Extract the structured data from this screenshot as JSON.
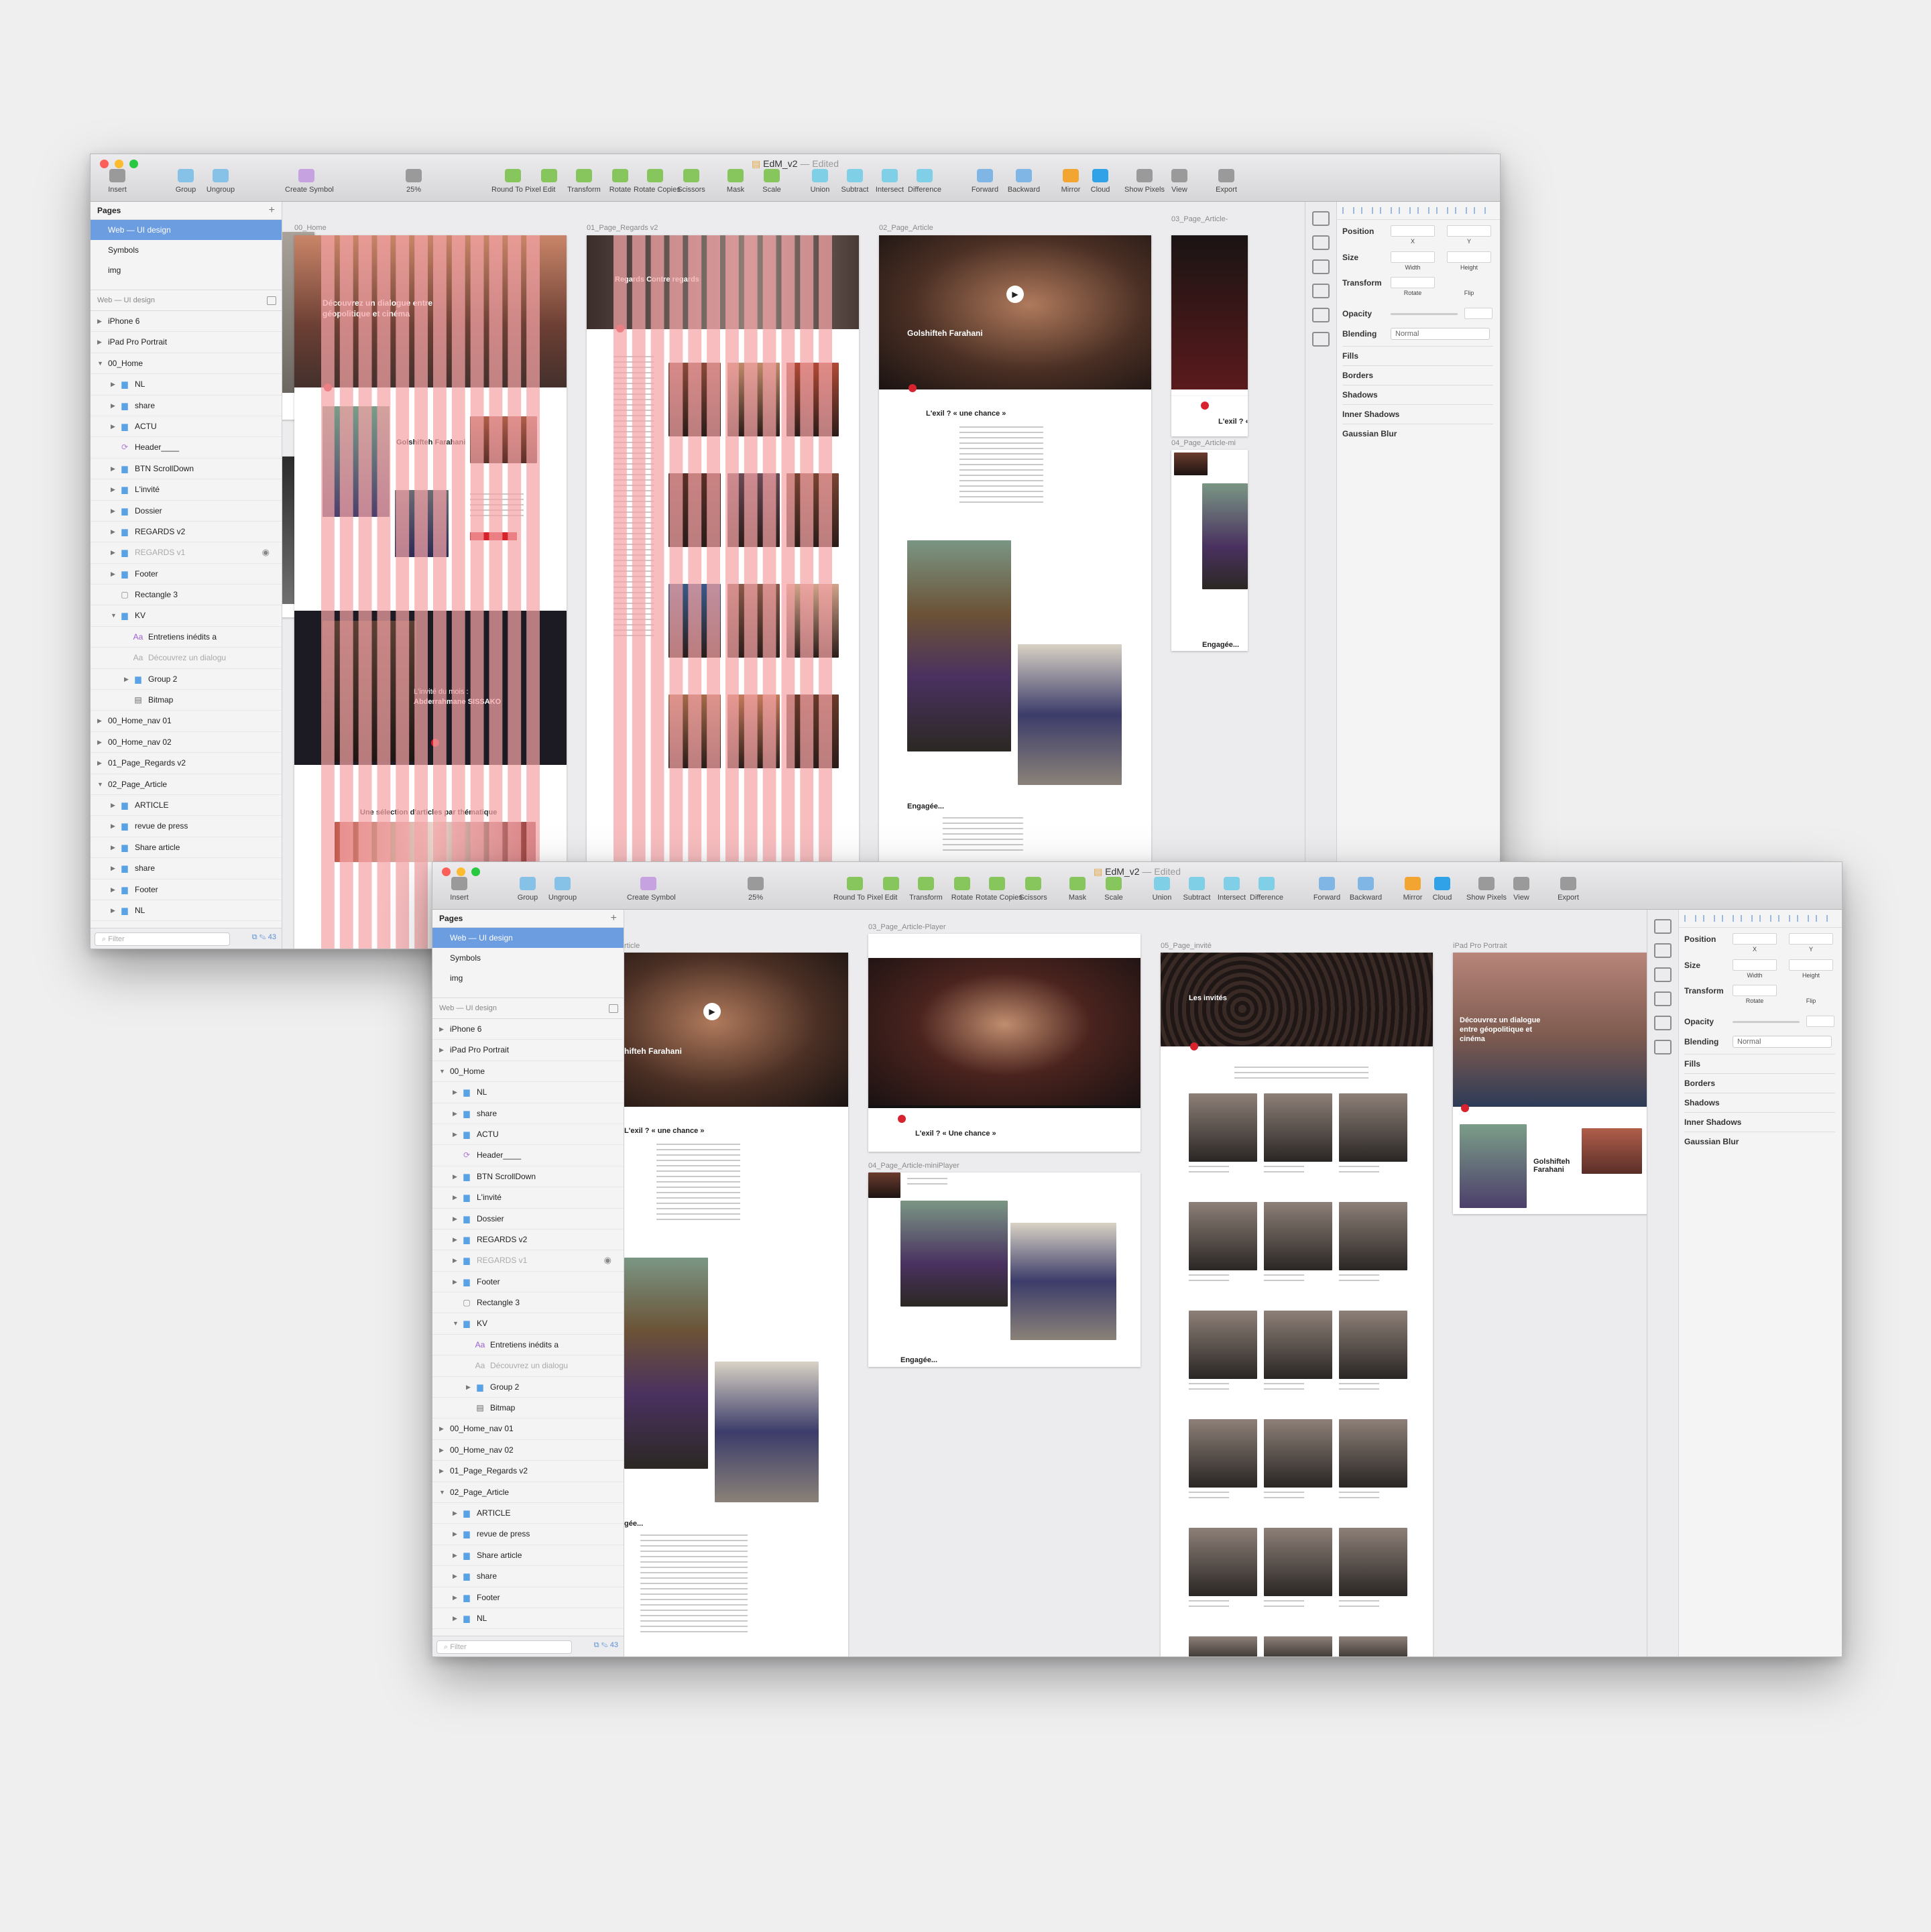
{
  "colors": {
    "accent": "#d8222e",
    "grid": "#f4a3a6",
    "selection": "#6c9de0",
    "canvas": "#ececee"
  },
  "window1": {
    "title": "EdM_v2",
    "edited": "— Edited",
    "zoom": "25%",
    "toolbar": [
      {
        "label": "Insert",
        "icon": "insert-icon"
      },
      {
        "label": "Group",
        "icon": "group-icon"
      },
      {
        "label": "Ungroup",
        "icon": "ungroup-icon"
      },
      {
        "label": "Create Symbol",
        "icon": "create-symbol-icon"
      },
      {
        "label": "25%",
        "icon": "zoom-icon"
      },
      {
        "label": "Round To Pixel",
        "icon": "round-to-pixel-icon"
      },
      {
        "label": "Edit",
        "icon": "edit-icon"
      },
      {
        "label": "Transform",
        "icon": "transform-icon"
      },
      {
        "label": "Rotate",
        "icon": "rotate-icon"
      },
      {
        "label": "Rotate Copies",
        "icon": "rotate-copies-icon"
      },
      {
        "label": "Scissors",
        "icon": "scissors-icon"
      },
      {
        "label": "Mask",
        "icon": "mask-icon"
      },
      {
        "label": "Scale",
        "icon": "scale-icon"
      },
      {
        "label": "Union",
        "icon": "union-icon"
      },
      {
        "label": "Subtract",
        "icon": "subtract-icon"
      },
      {
        "label": "Intersect",
        "icon": "intersect-icon"
      },
      {
        "label": "Difference",
        "icon": "difference-icon"
      },
      {
        "label": "Forward",
        "icon": "forward-icon"
      },
      {
        "label": "Backward",
        "icon": "backward-icon"
      },
      {
        "label": "Mirror",
        "icon": "mirror-icon"
      },
      {
        "label": "Cloud",
        "icon": "cloud-icon"
      },
      {
        "label": "Show Pixels",
        "icon": "show-pixels-icon"
      },
      {
        "label": "View",
        "icon": "view-icon"
      },
      {
        "label": "Export",
        "icon": "export-icon"
      }
    ],
    "pages_header": "Pages",
    "pages": [
      "Web — UI design",
      "Symbols",
      "img"
    ],
    "layers_header": "Web — UI design",
    "layers": [
      {
        "name": "iPhone 6",
        "depth": 0,
        "open": false,
        "kind": "artboard"
      },
      {
        "name": "iPad Pro Portrait",
        "depth": 0,
        "open": false,
        "kind": "artboard"
      },
      {
        "name": "00_Home",
        "depth": 0,
        "open": true,
        "kind": "artboard"
      },
      {
        "name": "NL",
        "depth": 1,
        "open": false,
        "kind": "folder"
      },
      {
        "name": "share",
        "depth": 1,
        "open": false,
        "kind": "folder"
      },
      {
        "name": "ACTU",
        "depth": 1,
        "open": false,
        "kind": "folder"
      },
      {
        "name": "Header____",
        "depth": 1,
        "kind": "symbol"
      },
      {
        "name": "BTN ScrollDown",
        "depth": 1,
        "open": false,
        "kind": "folder"
      },
      {
        "name": "L'invité",
        "depth": 1,
        "open": false,
        "kind": "folder"
      },
      {
        "name": "Dossier",
        "depth": 1,
        "open": false,
        "kind": "folder"
      },
      {
        "name": "REGARDS v2",
        "depth": 1,
        "open": false,
        "kind": "folder"
      },
      {
        "name": "REGARDS v1",
        "depth": 1,
        "open": false,
        "kind": "folder",
        "hidden": true
      },
      {
        "name": "Footer",
        "depth": 1,
        "open": false,
        "kind": "folder"
      },
      {
        "name": "Rectangle 3",
        "depth": 1,
        "kind": "shape"
      },
      {
        "name": "KV",
        "depth": 1,
        "open": true,
        "kind": "folder"
      },
      {
        "name": "Entretiens inédits a",
        "depth": 2,
        "kind": "text"
      },
      {
        "name": "Découvrez un dialogu",
        "depth": 2,
        "kind": "text-dim"
      },
      {
        "name": "Group 2",
        "depth": 2,
        "open": false,
        "kind": "folder"
      },
      {
        "name": "Bitmap",
        "depth": 2,
        "kind": "bitmap"
      },
      {
        "name": "00_Home_nav 01",
        "depth": 0,
        "open": false,
        "kind": "artboard"
      },
      {
        "name": "00_Home_nav 02",
        "depth": 0,
        "open": false,
        "kind": "artboard"
      },
      {
        "name": "01_Page_Regards v2",
        "depth": 0,
        "open": false,
        "kind": "artboard"
      },
      {
        "name": "02_Page_Article",
        "depth": 0,
        "open": true,
        "kind": "artboard"
      },
      {
        "name": "ARTICLE",
        "depth": 1,
        "open": false,
        "kind": "folder"
      },
      {
        "name": "revue de press",
        "depth": 1,
        "open": false,
        "kind": "folder"
      },
      {
        "name": "Share article",
        "depth": 1,
        "open": false,
        "kind": "folder"
      },
      {
        "name": "share",
        "depth": 1,
        "open": false,
        "kind": "folder"
      },
      {
        "name": "Footer",
        "depth": 1,
        "open": false,
        "kind": "folder"
      },
      {
        "name": "NL",
        "depth": 1,
        "open": false,
        "kind": "folder"
      }
    ],
    "filter_placeholder": "Filter",
    "layer_count": "43",
    "artboards": {
      "home": {
        "label": "00_Home",
        "hero_text": "Découvrez un dialogue entre géopolitique et cinéma",
        "name": "Golshifteh Farahani",
        "guest_title": "L'invité du mois :",
        "guest_name": "Abderrahmane SISSAKO",
        "selection_text": "Une sélection d'articles par thématique"
      },
      "regards": {
        "label": "01_Page_Regards v2",
        "hero_text": "Regards Contre regards"
      },
      "article": {
        "label": "02_Page_Article",
        "name": "Golshifteh Farahani",
        "heading": "L'exil ? « une chance »",
        "engaged": "Engagée..."
      },
      "article_cut": {
        "label": "03_Page_Article-",
        "heading": "L'exil ? «",
        "mini_label": "04_Page_Article-mi",
        "engaged": "Engagée..."
      }
    },
    "inspector": {
      "position": "Position",
      "x": "X",
      "y": "Y",
      "size": "Size",
      "width": "Width",
      "height": "Height",
      "transform": "Transform",
      "rotate": "Rotate",
      "flip": "Flip",
      "opacity": "Opacity",
      "blending": "Blending",
      "blending_value": "Normal",
      "fills": "Fills",
      "borders": "Borders",
      "shadows": "Shadows",
      "inner_shadows": "Inner Shadows",
      "gaussian_blur": "Gaussian Blur"
    }
  },
  "window2": {
    "title": "EdM_v2",
    "edited": "— Edited",
    "artboards": {
      "article": {
        "label": "rticle",
        "name": "hifteh Farahani",
        "heading": "L'exil ? « une chance »",
        "engaged": "gée..."
      },
      "player": {
        "label": "03_Page_Article-Player",
        "heading": "L'exil ? « Une chance »"
      },
      "miniplayer": {
        "label": "04_Page_Article-miniPlayer",
        "engaged": "Engagée..."
      },
      "guest": {
        "label": "05_Page_invité",
        "title": "Les invités"
      },
      "ipad": {
        "label": "iPad Pro Portrait",
        "hero_text": "Découvrez un dialogue entre géopolitique et cinéma",
        "name": "Golshifteh Farahani"
      }
    }
  }
}
